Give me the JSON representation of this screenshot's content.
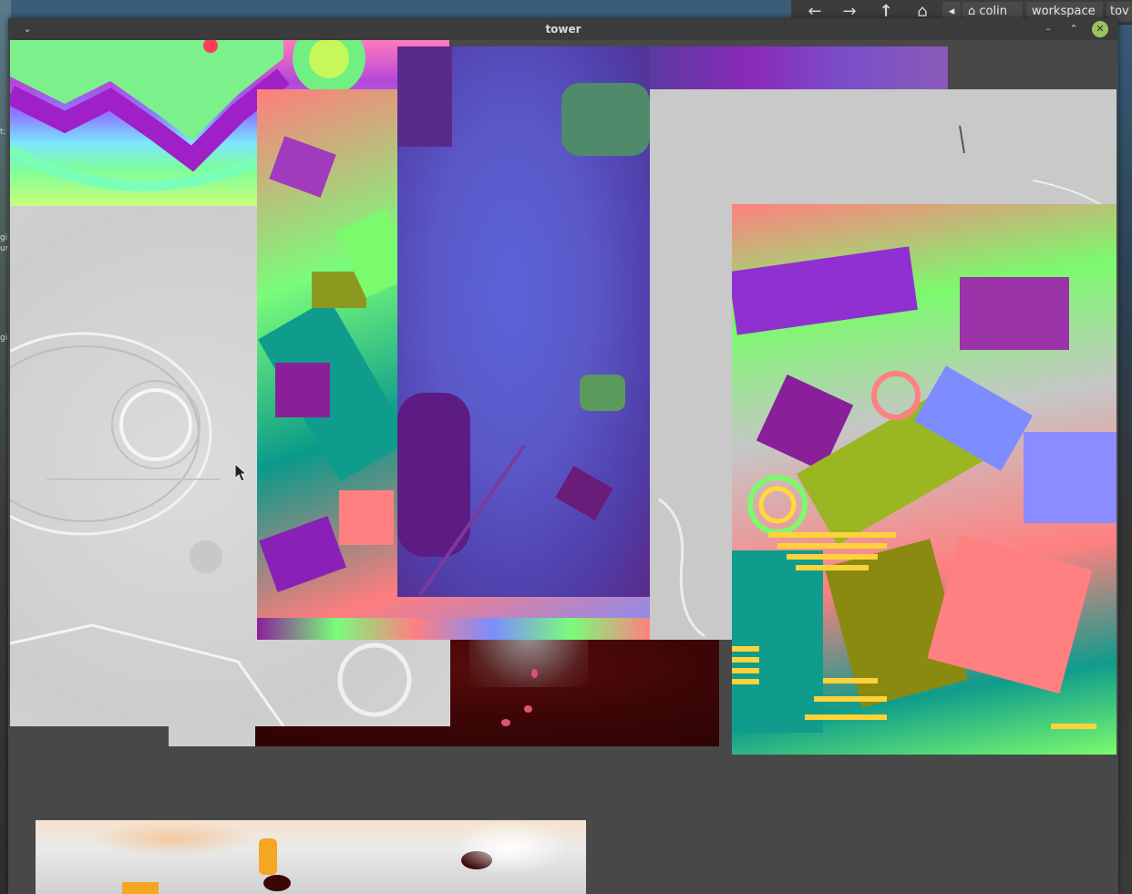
{
  "window": {
    "title": "tower",
    "menu_glyph": "⌄",
    "minimize_glyph": "–",
    "maximize_glyph": "⌃",
    "close_glyph": "✕"
  },
  "file_manager": {
    "back_glyph": "←",
    "forward_glyph": "→",
    "up_glyph": "↑",
    "home_glyph": "⌂",
    "scroll_left_glyph": "◂",
    "breadcrumbs": [
      "colin",
      "workspace",
      "tov"
    ]
  },
  "desktop_fragments": [
    "t:",
    "gil",
    "ur",
    "gil"
  ],
  "textures": [
    {
      "name": "rainbow-normal-map"
    },
    {
      "name": "grey-height-map"
    },
    {
      "name": "dark-maroon-map"
    },
    {
      "name": "colorful-normal-map-left"
    },
    {
      "name": "blue-purple-noise-map"
    },
    {
      "name": "light-grey-map"
    },
    {
      "name": "colorful-normal-map-right"
    },
    {
      "name": "orange-heat-map"
    }
  ],
  "icons": {
    "mouse_cursor": "mouse-cursor-icon"
  }
}
